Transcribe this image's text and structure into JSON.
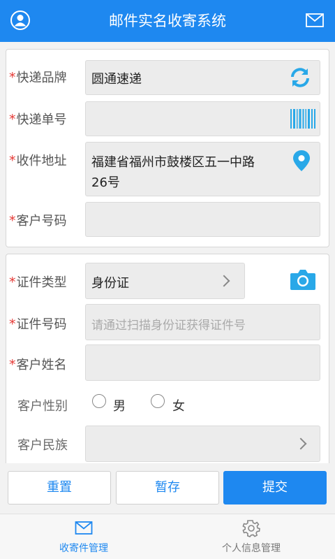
{
  "header": {
    "title": "邮件实名收寄系统"
  },
  "section1": {
    "brand_label": "快递品牌",
    "brand_value": "圆通速递",
    "tracking_label": "快递单号",
    "tracking_value": "",
    "address_label": "收件地址",
    "address_line1": "福建省福州市鼓楼区五一中路",
    "address_line2": "26号",
    "customer_no_label": "客户号码",
    "customer_no_value": ""
  },
  "section2": {
    "id_type_label": "证件类型",
    "id_type_value": "身份证",
    "id_number_label": "证件号码",
    "id_number_placeholder": "请通过扫描身份证获得证件号",
    "name_label": "客户姓名",
    "name_value": "",
    "gender_label": "客户性别",
    "gender_options": [
      "男",
      "女"
    ],
    "ethnicity_label": "客户民族",
    "ethnicity_value": ""
  },
  "required_mark": "*",
  "actions": {
    "reset": "重置",
    "save": "暂存",
    "submit": "提交"
  },
  "tabbar": {
    "tab1": "收寄件管理",
    "tab2": "个人信息管理"
  },
  "colors": {
    "primary": "#1e88f0",
    "required": "#e53935",
    "icon_blue": "#29a8e8"
  }
}
